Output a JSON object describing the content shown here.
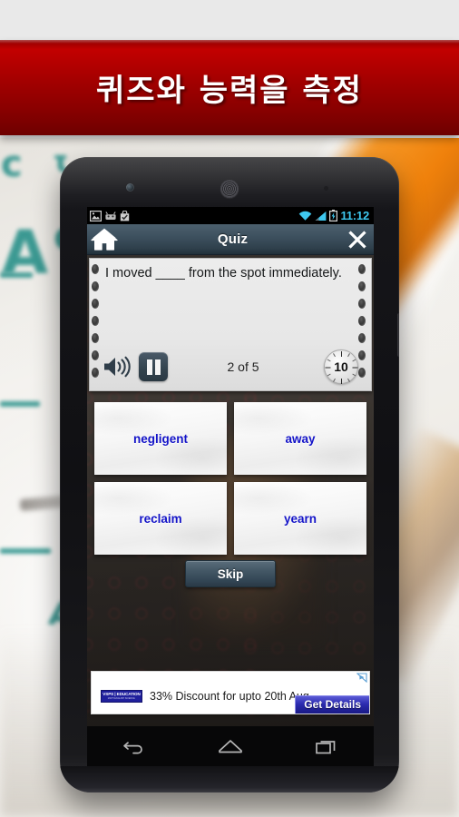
{
  "banner": {
    "title": "퀴즈와 능력을 측정",
    "background_color": "#a40000",
    "text_color": "#ffffff"
  },
  "device": {
    "name": "android-phone-frame",
    "frame_color": "#101013"
  },
  "status_bar": {
    "icons": [
      "image-icon",
      "android-robot-icon",
      "play-store-bag-icon"
    ],
    "right_icons": [
      "wifi-icon",
      "cellular-signal-icon",
      "battery-charging-icon"
    ],
    "clock": "11:12",
    "clock_color": "#3ec8f0",
    "background_color": "#000000"
  },
  "action_bar": {
    "home_icon": "home-icon",
    "title": "Quiz",
    "close_icon": "close-icon",
    "background_color": "#3c4f5d"
  },
  "question_card": {
    "text": "I moved ____ from the spot immediately.",
    "speaker_icon": "speaker-volume-icon",
    "pause_icon": "pause-icon",
    "progress": "2 of 5",
    "timer_value": "10",
    "paper_color": "#ececec"
  },
  "options": [
    {
      "label": "negligent"
    },
    {
      "label": "away"
    },
    {
      "label": "reclaim"
    },
    {
      "label": "yearn"
    }
  ],
  "option_text_color": "#1414c8",
  "skip_button": {
    "label": "Skip"
  },
  "ad": {
    "choices_icon": "ad-choices-icon",
    "logo_primary": "VSPS | EDUCATION",
    "logo_secondary": "MATH ENGLISH SCIENCE",
    "text": "33% Discount for upto 20th Aug",
    "cta_label": "Get Details",
    "cta_color": "#2b2bb0"
  },
  "nav_bar": {
    "buttons": [
      {
        "name": "back-button",
        "icon": "back-arrow-icon"
      },
      {
        "name": "home-button",
        "icon": "home-outline-icon"
      },
      {
        "name": "recents-button",
        "icon": "recents-squares-icon"
      }
    ],
    "background_color": "#070708"
  }
}
